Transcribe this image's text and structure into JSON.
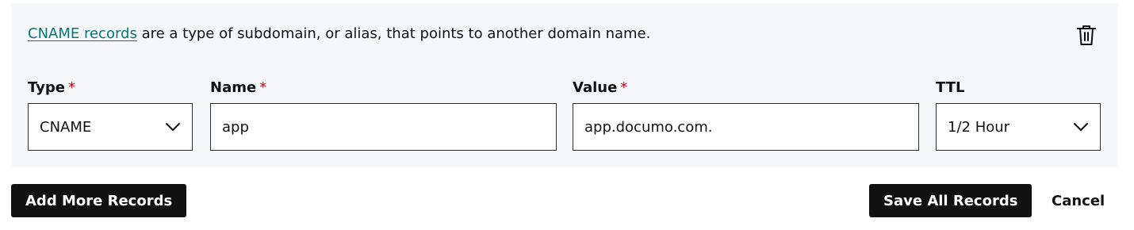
{
  "info": {
    "link_text": "CNAME records",
    "rest_text": " are a type of subdomain, or alias, that points to another domain name."
  },
  "icons": {
    "delete": "trash-icon",
    "dropdown": "chevron-down-icon"
  },
  "form": {
    "type": {
      "label": "Type",
      "required_mark": "*",
      "value": "CNAME"
    },
    "name": {
      "label": "Name",
      "required_mark": "*",
      "value": "app"
    },
    "value": {
      "label": "Value",
      "required_mark": "*",
      "value": "app.documo.com."
    },
    "ttl": {
      "label": "TTL",
      "value": "1/2 Hour"
    }
  },
  "actions": {
    "add_more": "Add More Records",
    "save_all": "Save All Records",
    "cancel": "Cancel"
  },
  "colors": {
    "link": "#09757a",
    "required": "#d0021b",
    "panel_bg": "#f5f7f8",
    "button_bg": "#111111"
  }
}
